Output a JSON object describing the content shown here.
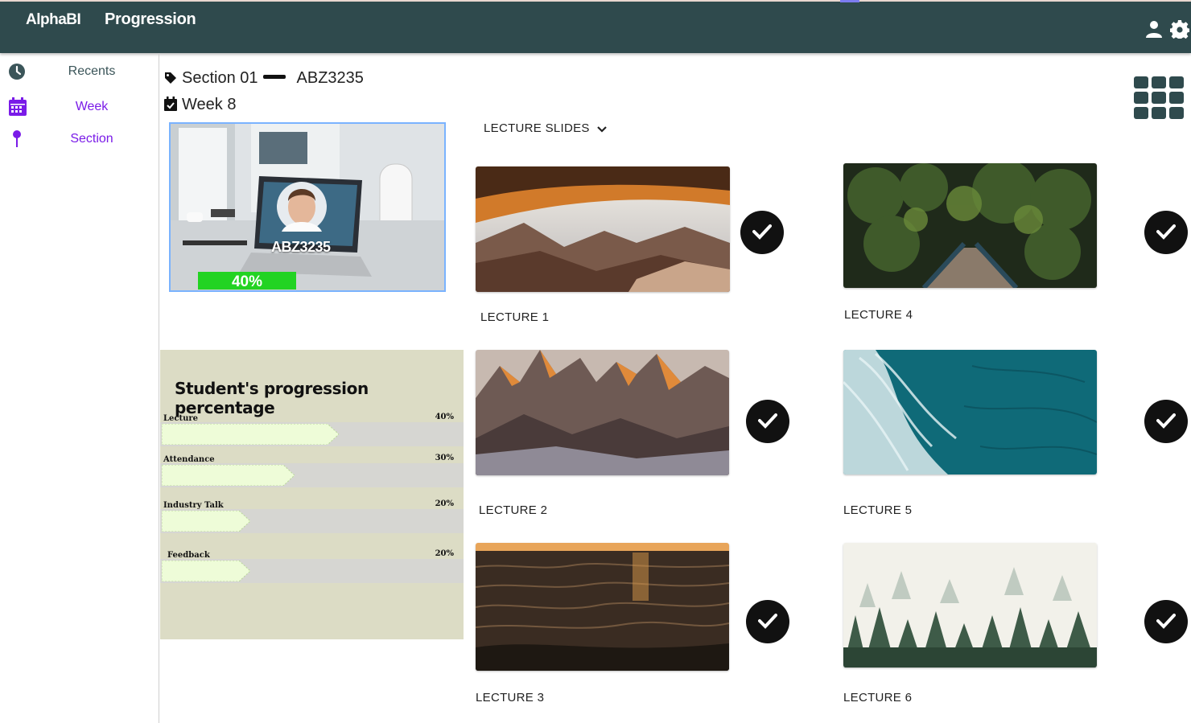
{
  "app": {
    "brand": "AlphaBI",
    "title": "Progression"
  },
  "sidebar": {
    "items": [
      {
        "label": "Recents",
        "icon": "clock-icon"
      },
      {
        "label": "Week",
        "icon": "calendar-icon"
      },
      {
        "label": "Section",
        "icon": "pin-icon"
      }
    ]
  },
  "header": {
    "section": "Section 01",
    "course_code": "ABZ3235",
    "week": "Week 8"
  },
  "video": {
    "id": "ABZ3235",
    "progress_label": "40%",
    "progress": 0.4
  },
  "progression": {
    "title": "Student's progression percentage",
    "rows": [
      {
        "label": "Lecture",
        "pct_label": "40%",
        "value": 0.4
      },
      {
        "label": "Attendance",
        "pct_label": "30%",
        "value": 0.3
      },
      {
        "label": "Industry Talk",
        "pct_label": "20%",
        "value": 0.2
      },
      {
        "label": "Feedback",
        "pct_label": "20%",
        "value": 0.2
      }
    ]
  },
  "lectures": {
    "dropdown_label": "LECTURE SLIDES",
    "items": [
      {
        "label": "LECTURE 1",
        "completed": true
      },
      {
        "label": "LECTURE 2",
        "completed": true
      },
      {
        "label": "LECTURE 3",
        "completed": true
      },
      {
        "label": "LECTURE 4",
        "completed": true
      },
      {
        "label": "LECTURE 5",
        "completed": true
      },
      {
        "label": "LECTURE 6",
        "completed": true
      }
    ]
  },
  "colors": {
    "topbar": "#2f4a4d",
    "accent_purple": "#7a1be8",
    "progress_green": "#22d322",
    "panel_bg": "#dcdcc5"
  }
}
